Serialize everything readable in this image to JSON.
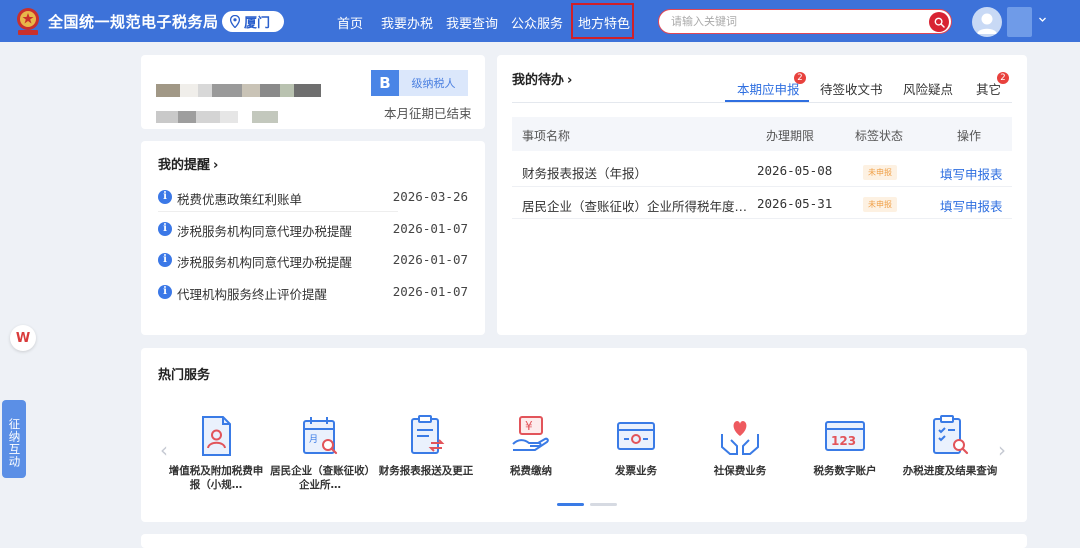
{
  "header": {
    "site_title": "全国统一规范电子税务局",
    "city": "厦门",
    "nav": [
      "首页",
      "我要办税",
      "我要查询",
      "公众服务",
      "地方特色"
    ],
    "search_placeholder": "请输入关键词"
  },
  "profile": {
    "taxpayer_grade": "B",
    "taxpayer_type": "级纳税人",
    "month_status": "本月征期已结束"
  },
  "reminders": {
    "title": "我的提醒",
    "chevron": "›",
    "items": [
      {
        "text": "税费优惠政策红利账单",
        "date": "2026-03-26"
      },
      {
        "text": "涉税服务机构同意代理办税提醒",
        "date": "2026-01-07"
      },
      {
        "text": "涉税服务机构同意代理办税提醒",
        "date": "2026-01-07"
      },
      {
        "text": "代理机构服务终止评价提醒",
        "date": "2026-01-07"
      }
    ]
  },
  "todo": {
    "title": "我的待办",
    "chevron": "›",
    "tabs": [
      {
        "label": "本期应申报",
        "badge": "2"
      },
      {
        "label": "待签收文书",
        "badge": ""
      },
      {
        "label": "风险疑点",
        "badge": ""
      },
      {
        "label": "其它",
        "badge": "2"
      }
    ],
    "columns": [
      "事项名称",
      "办理期限",
      "标签状态",
      "操作"
    ],
    "rows": [
      {
        "name": "财务报表报送（年报）",
        "deadline": "2026-05-08",
        "status": "未申报",
        "action": "填写申报表"
      },
      {
        "name": "居民企业（查账征收）企业所得税年度…",
        "deadline": "2026-05-31",
        "status": "未申报",
        "action": "填写申报表"
      }
    ]
  },
  "hot_services": {
    "title": "热门服务",
    "prev": "‹",
    "next": "›",
    "items": [
      {
        "label": "增值税及附加税费申报（小规…",
        "icon": "tax-form-person-icon"
      },
      {
        "label": "居民企业（查账征收）企业所…",
        "icon": "calendar-search-icon"
      },
      {
        "label": "财务报表报送及更正",
        "icon": "report-exchange-icon"
      },
      {
        "label": "税费缴纳",
        "icon": "yuan-hand-icon"
      },
      {
        "label": "发票业务",
        "icon": "invoice-icon"
      },
      {
        "label": "社保费业务",
        "icon": "heart-hands-icon"
      },
      {
        "label": "税务数字账户",
        "icon": "digital-account-icon"
      },
      {
        "label": "办税进度及结果查询",
        "icon": "progress-search-icon"
      }
    ]
  },
  "sidebar": {
    "floating_w": "W",
    "interaction_tab": "征纳互动"
  },
  "colors": {
    "header_blue": "#3d72d9",
    "highlight_red": "#d0202a",
    "link_blue": "#2f6fe0",
    "badge_red": "#e8413d",
    "status_orange": "#f0a14a"
  }
}
